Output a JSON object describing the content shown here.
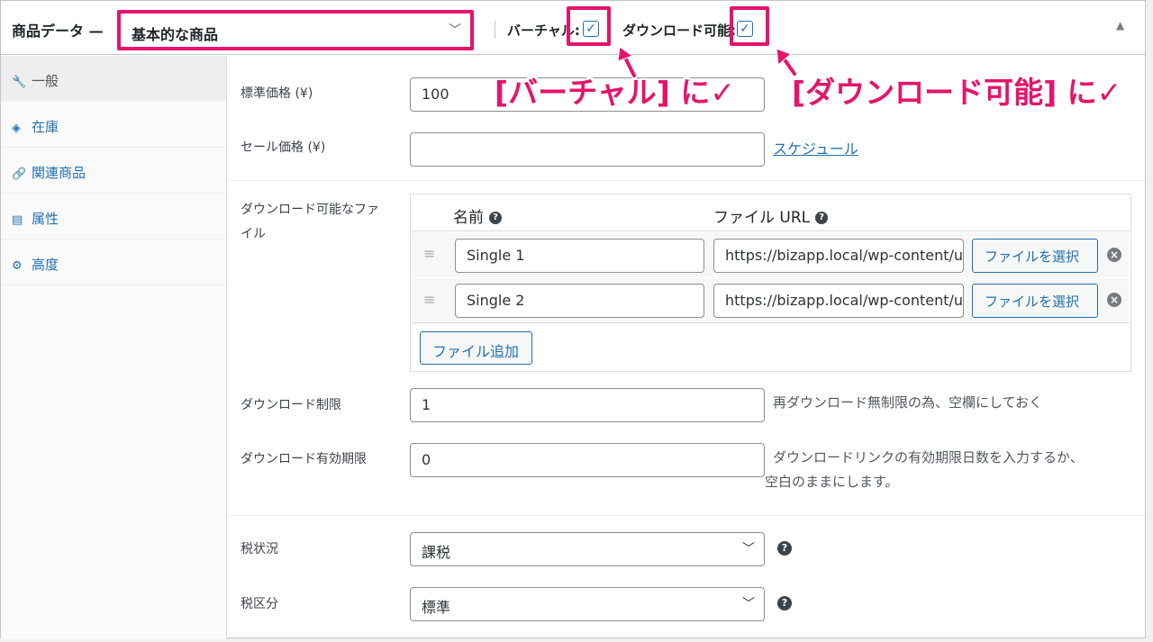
{
  "header": {
    "title": "商品データ —",
    "product_type": "基本的な商品",
    "virtual_label": "バーチャル:",
    "downloadable_label": "ダウンロード可能:",
    "virtual_checked": true,
    "downloadable_checked": true
  },
  "sidebar": {
    "items": [
      {
        "label": "一般",
        "icon": "wrench-icon",
        "glyph": "🔧"
      },
      {
        "label": "在庫",
        "icon": "tag-icon",
        "glyph": "◈"
      },
      {
        "label": "関連商品",
        "icon": "link-icon",
        "glyph": "🔗"
      },
      {
        "label": "属性",
        "icon": "list-icon",
        "glyph": "▤"
      },
      {
        "label": "高度",
        "icon": "gear-icon",
        "glyph": "⚙"
      }
    ]
  },
  "general": {
    "regular_price_label": "標準価格 (¥)",
    "regular_price_value": "100",
    "sale_price_label": "セール価格 (¥)",
    "sale_price_value": "",
    "schedule_link": "スケジュール"
  },
  "downloads": {
    "section_label_line1": "ダウンロード可能なファ",
    "section_label_line2": "イル",
    "col_name": "名前",
    "col_url": "ファイル URL",
    "files": [
      {
        "name": "Single 1",
        "url": "https://bizapp.local/wp-content/u",
        "button": "ファイルを選択"
      },
      {
        "name": "Single 2",
        "url": "https://bizapp.local/wp-content/u",
        "button": "ファイルを選択"
      }
    ],
    "add_file_button": "ファイル追加",
    "limit_label": "ダウンロード制限",
    "limit_value": "1",
    "limit_desc": "再ダウンロード無制限の為、空欄にしておく",
    "expiry_label": "ダウンロード有効期限",
    "expiry_value": "0",
    "expiry_desc_line1": "ダウンロードリンクの有効期限日数を入力するか、",
    "expiry_desc_line2": "空白のままにします。"
  },
  "tax": {
    "status_label": "税状況",
    "status_value": "課税",
    "class_label": "税区分",
    "class_value": "標準"
  },
  "annotations": {
    "virtual_note": "[バーチャル] に✓",
    "downloadable_note": "[ダウンロード可能] に✓",
    "color": "#e5146b"
  }
}
